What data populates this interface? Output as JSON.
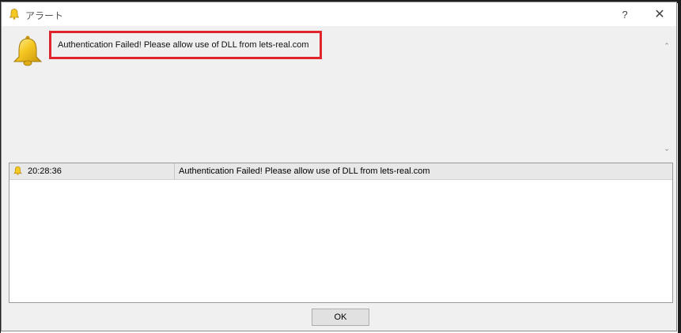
{
  "window": {
    "title": "アラート",
    "help_label": "?",
    "close_label": "✕"
  },
  "alert": {
    "message": "Authentication Failed! Please allow use of DLL  from lets-real.com"
  },
  "log": {
    "rows": [
      {
        "time": "20:28:36",
        "message": "Authentication Failed! Please allow use of DLL  from lets-real.com"
      }
    ]
  },
  "buttons": {
    "ok_label": "OK"
  },
  "colors": {
    "highlight_border": "#e0242c",
    "bell_fill": "#f6c823"
  },
  "icons": {
    "title": "bell-icon",
    "large": "bell-icon",
    "row": "bell-icon"
  }
}
